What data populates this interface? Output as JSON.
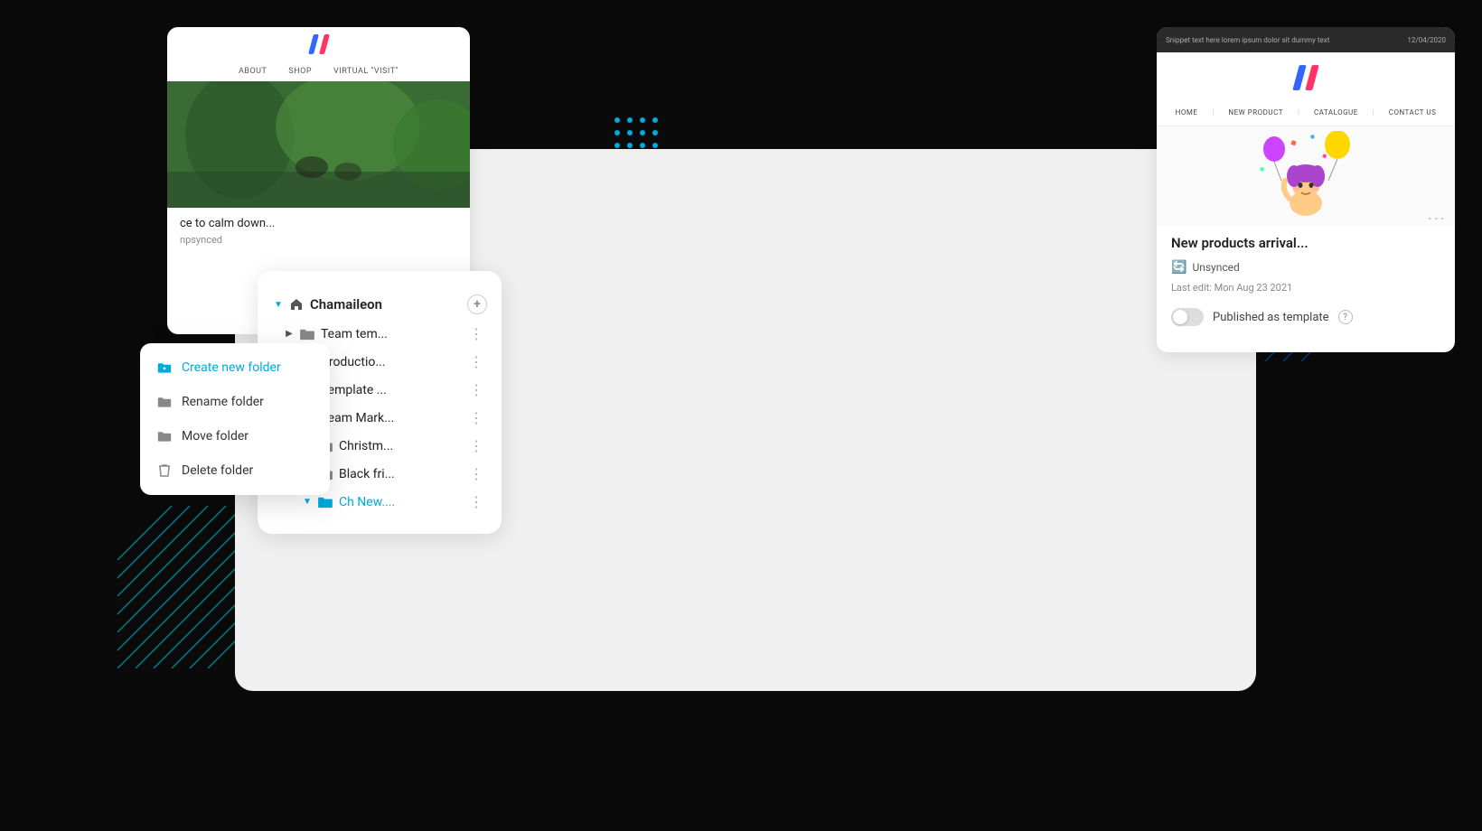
{
  "background": "#0a0a0a",
  "accent_color": "#00aadd",
  "folder_panel": {
    "root_label": "Chamaileon",
    "add_button": "+",
    "items": [
      {
        "label": "Team tem...",
        "level": 1,
        "expanded": false,
        "active": false
      },
      {
        "label": "Productio...",
        "level": 1,
        "expanded": false,
        "active": false
      },
      {
        "label": "Template ...",
        "level": 1,
        "expanded": false,
        "active": false
      },
      {
        "label": "Team Mark...",
        "level": 1,
        "expanded": true,
        "active": false
      },
      {
        "label": "Christm...",
        "level": 2,
        "expanded": false,
        "active": false
      },
      {
        "label": "Black fri...",
        "level": 2,
        "expanded": false,
        "active": false
      },
      {
        "label": "Ch New....",
        "level": 2,
        "expanded": true,
        "active": true
      }
    ]
  },
  "context_menu": {
    "items": [
      {
        "label": "Create new folder",
        "icon": "folder-plus",
        "active": true
      },
      {
        "label": "Rename folder",
        "icon": "folder-edit",
        "active": false
      },
      {
        "label": "Move folder",
        "icon": "folder-move",
        "active": false
      },
      {
        "label": "Delete folder",
        "icon": "trash",
        "active": false
      }
    ]
  },
  "website_preview": {
    "nav_links": [
      "About",
      "Shop",
      "Virtual \"Visit\""
    ],
    "caption": "ce to calm down...",
    "subcaption": "npsynced"
  },
  "card_panel": {
    "top_bar_text": "Snippet text here lorem ipsum dolor sit dummy text",
    "top_bar_date": "12/04/2020",
    "nav_links": [
      "Home",
      "New Product",
      "Catalogue",
      "Contact Us"
    ],
    "title": "New products arrival...",
    "status": "Unsynced",
    "last_edit": "Last edit: Mon Aug 23 2021",
    "template_label": "Published as template",
    "more_btn": "⋮"
  }
}
